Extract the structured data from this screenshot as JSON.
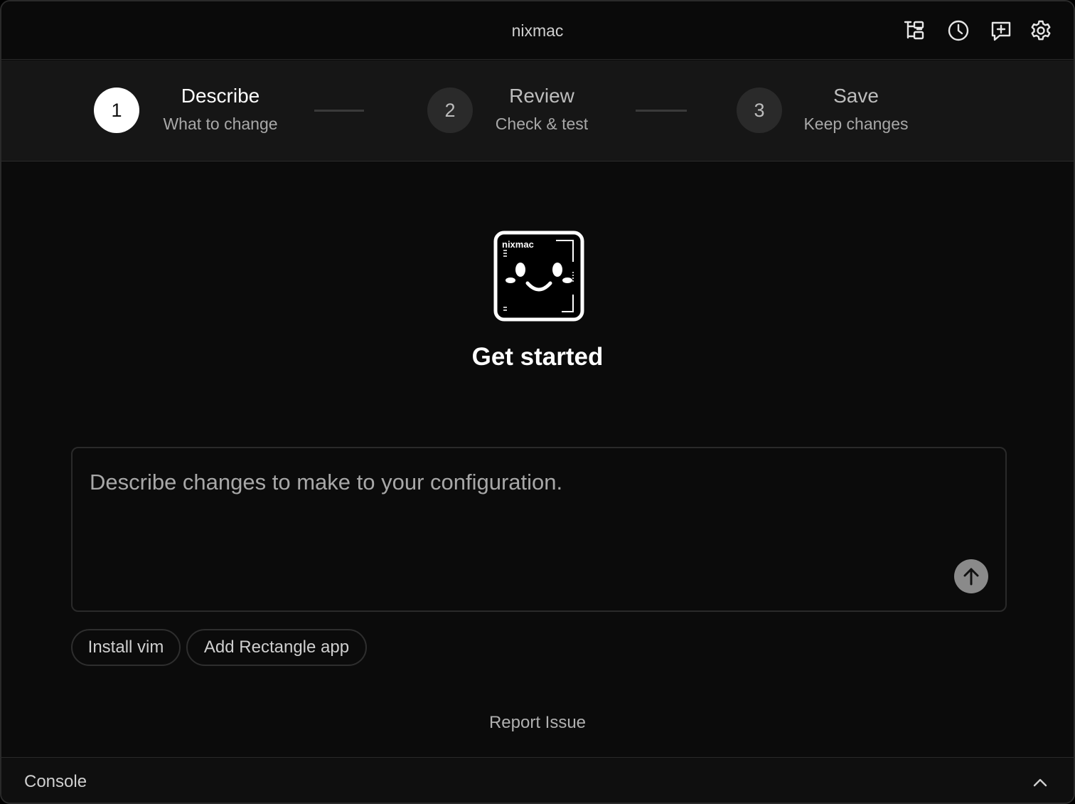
{
  "window": {
    "title": "nixmac"
  },
  "toolbar": {
    "icons": [
      "tree-icon",
      "history-icon",
      "new-message-icon",
      "gear-icon"
    ]
  },
  "stepper": {
    "steps": [
      {
        "number": "1",
        "title": "Describe",
        "subtitle": "What to change",
        "active": true
      },
      {
        "number": "2",
        "title": "Review",
        "subtitle": "Check & test",
        "active": false
      },
      {
        "number": "3",
        "title": "Save",
        "subtitle": "Keep changes",
        "active": false
      }
    ]
  },
  "main": {
    "logo_text": "nixmac",
    "heading": "Get started",
    "prompt_placeholder": "Describe changes to make to your configuration.",
    "prompt_value": "",
    "suggestions": [
      "Install vim",
      "Add Rectangle app"
    ],
    "report_link": "Report Issue"
  },
  "console": {
    "label": "Console",
    "toggle_icon": "chevron-up-icon"
  },
  "colors": {
    "background": "#0b0b0b",
    "active_step": "#ffffff",
    "inactive_step": "#2a2a2a",
    "send_button": "#8a8a8a"
  }
}
